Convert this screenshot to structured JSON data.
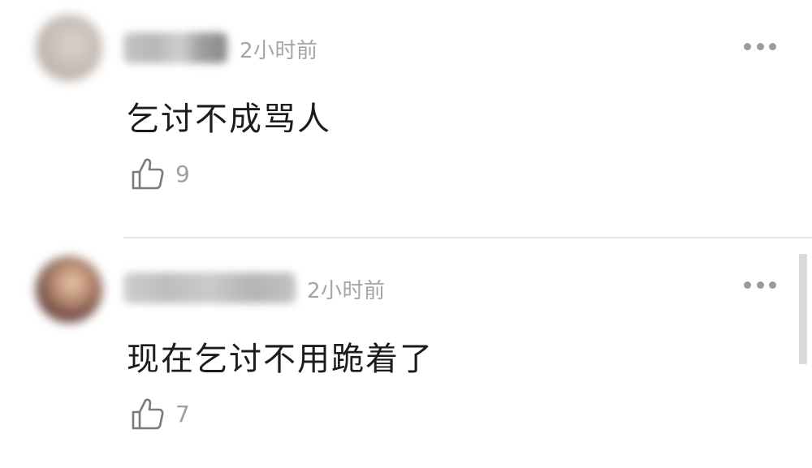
{
  "comments": [
    {
      "time": "2小时前",
      "text": "乞讨不成骂人",
      "likes": "9",
      "avatar_icon": "user-avatar-blurred",
      "username_icon": "username-blurred"
    },
    {
      "time": "2小时前",
      "text": "现在乞讨不用跪着了",
      "likes": "7",
      "avatar_icon": "user-avatar-blurred",
      "username_icon": "username-blurred"
    }
  ],
  "icons": {
    "like": "thumbs-up-icon",
    "more": "more-dots-icon"
  },
  "colors": {
    "text": "#1c1c1c",
    "meta": "#a5a5a5",
    "divider": "#e6e6e6"
  }
}
